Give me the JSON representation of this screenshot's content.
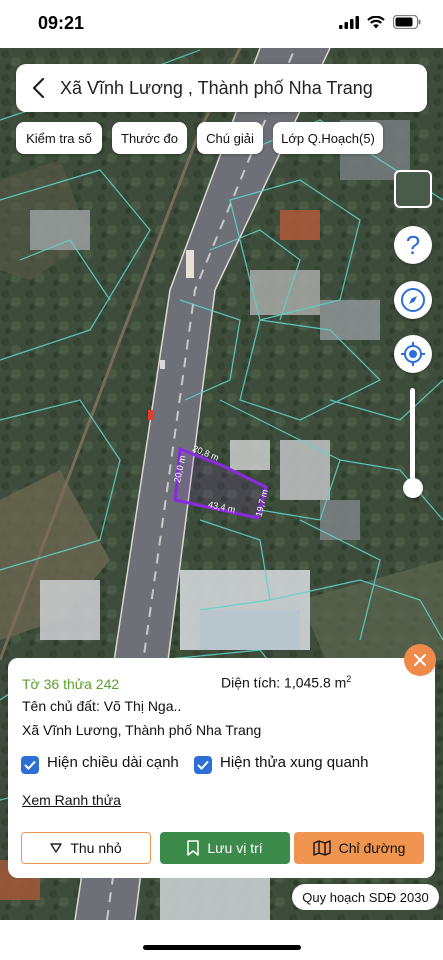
{
  "status_bar": {
    "time": "09:21"
  },
  "header": {
    "title": "Xã Vĩnh Lương , Thành phố Nha Trang"
  },
  "toolbar": {
    "check_number": "Kiểm tra số",
    "ruler": "Thước đo",
    "legend": "Chú giải",
    "planning_layer": "Lớp Q.Hoạch(5)"
  },
  "map": {
    "edge_labels": [
      "20,8 m",
      "20,0 m",
      "43,4 m",
      "19,7 m"
    ],
    "highlight_color": "#8a2be2",
    "parcel_line_color": "#5fd3c8"
  },
  "controls": {
    "help": "?"
  },
  "info": {
    "sheet_parcel": "Tờ 36 thửa 242",
    "area_label": "Diện tích: 1,045.8 m",
    "area_sup": "2",
    "owner": "Tên chủ đất: Võ Thị Nga..",
    "address": "Xã Vĩnh Lương, Thành phố Nha Trang",
    "show_edge_length": "Hiện chiều dài cạnh",
    "show_neighbors": "Hiện thửa xung quanh",
    "view_boundary": "Xem Ranh thửa"
  },
  "actions": {
    "minimize": "Thu nhỏ",
    "save_location": "Lưu vị trí",
    "directions": "Chỉ đường"
  },
  "badge": "Quy hoạch SDĐ 2030",
  "colors": {
    "green": "#5aa02c",
    "orange": "#f0954f",
    "blue": "#2d6fd6",
    "save_green": "#3d8b4a"
  }
}
